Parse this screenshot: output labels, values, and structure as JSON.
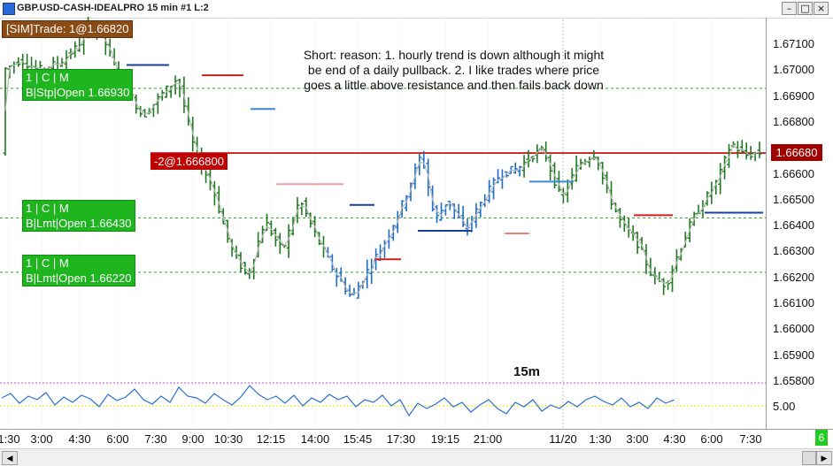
{
  "window": {
    "title": "GBP.USD-CASH-IDEALPRO  15 min   #1   L:2",
    "buttons": {
      "minimize": "–",
      "maximize": "□",
      "close": "×"
    }
  },
  "sim_badge": "[SIM]Trade: 1@1.66820",
  "orders": [
    {
      "qty": "1",
      "c": "C",
      "m": "M",
      "desc": "B|Stp|Open  1.66930"
    },
    {
      "qty": "1",
      "c": "C",
      "m": "M",
      "desc": "B|Lmt|Open  1.66430"
    },
    {
      "qty": "1",
      "c": "C",
      "m": "M",
      "desc": "B|Lmt|Open  1.66220"
    }
  ],
  "position_badge": "-2@1.666800",
  "annotation_text": "Short: reason: 1. hourly trend is down although it might be end of a daily pullback. 2. I like trades where price goes a little above resistance and then fails back down",
  "timeframe_label": "15m",
  "last_price_label": "1.66680",
  "indicator_label": "5.00",
  "corner_badge": "6",
  "scroll": {
    "left": "◀",
    "right": "▶"
  },
  "colors": {
    "up_bar": "#1f7a1f",
    "down_bar": "#1e6ec8",
    "position_line": "#c00000",
    "order_line": "#22aa22",
    "indicator_line": "#2a6fd0",
    "indicator_ref_magenta": "#cc44cc",
    "indicator_ref_yellow": "#e6e600"
  },
  "chart_data": {
    "type": "ohlc",
    "title": "GBP.USD-CASH-IDEALPRO  15 min",
    "y_ticks": [
      "1.67100",
      "1.67000",
      "1.66900",
      "1.66800",
      "1.66600",
      "1.66500",
      "1.66400",
      "1.66300",
      "1.66200",
      "1.66100",
      "1.66000",
      "1.65900",
      "1.65800"
    ],
    "x_ticks": [
      "1:30",
      "3:00",
      "4:30",
      "6:00",
      "7:30",
      "9:00",
      "10:30",
      "12:15",
      "14:00",
      "15:45",
      "17:30",
      "19:15",
      "21:00",
      "11/20",
      "1:30",
      "3:00",
      "4:30",
      "6:00",
      "7:30"
    ],
    "ylim": [
      1.658,
      1.672
    ],
    "grid": false,
    "horizontal_levels": [
      {
        "price": 1.6668,
        "kind": "position",
        "label": "-2@1.666800"
      },
      {
        "price": 1.6693,
        "kind": "order",
        "label": "B|Stp|Open 1.66930"
      },
      {
        "price": 1.6643,
        "kind": "order",
        "label": "B|Lmt|Open 1.66430"
      },
      {
        "price": 1.6622,
        "kind": "order",
        "label": "B|Lmt|Open 1.66220"
      }
    ],
    "price_approx": {
      "start": 1.6702,
      "peak": 1.6718,
      "mid_low": 1.661,
      "rebound": 1.6669,
      "late_low": 1.6617,
      "close": 1.6668
    },
    "indicator": {
      "reference_level": 5.0
    }
  }
}
